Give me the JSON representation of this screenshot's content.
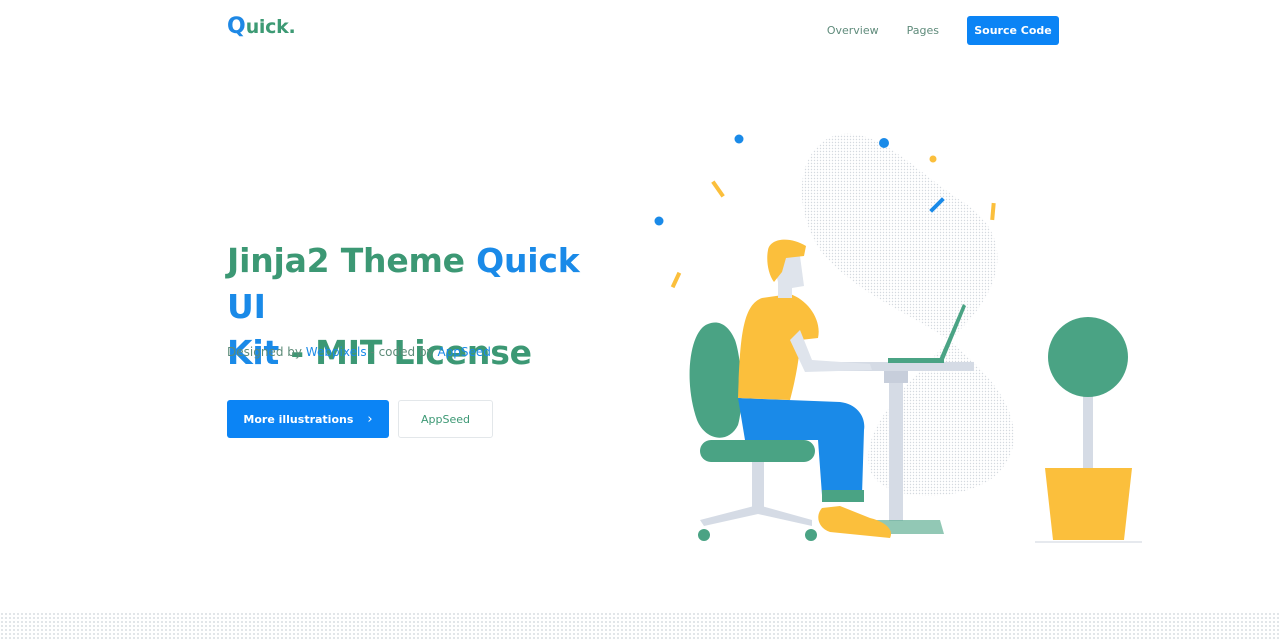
{
  "brand": {
    "q": "Q",
    "rest": "uick."
  },
  "nav": {
    "overview": "Overview",
    "pages": "Pages",
    "cta": "Source Code"
  },
  "hero": {
    "title_part1": "Jinja2 Theme ",
    "title_part2": "Quick UI",
    "title_part3": "Kit",
    "title_part4": " - MIT License",
    "sub_prefix": "Designed by ",
    "sub_link1": "Webpixels",
    "sub_middle": " - coded by ",
    "sub_link2": "AppSeed",
    "primary_button": "More illustrations",
    "primary_icon": "chevron-right-icon",
    "secondary_button": "AppSeed"
  },
  "colors": {
    "blue": "#0b84f5",
    "green": "#3c9874",
    "yellow": "#fbbf3c",
    "chair_green": "#4aa384",
    "pants_blue": "#1a8ae8",
    "grey_blob": "#eceff3"
  }
}
